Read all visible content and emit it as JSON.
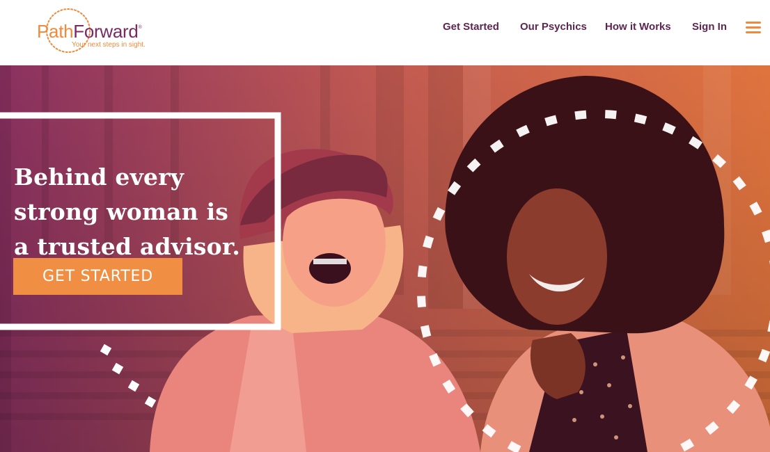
{
  "brand": {
    "name_part1": "Path",
    "name_part2": "Forward",
    "trademark": "®",
    "tagline": "Your next steps in sight.",
    "colors": {
      "orange": "#f08a3a",
      "plum": "#7a2a63"
    }
  },
  "nav": {
    "links": [
      {
        "label": "Get Started"
      },
      {
        "label": "Our Psychics"
      },
      {
        "label": "How it Works"
      },
      {
        "label": "Sign In"
      }
    ],
    "menu_icon": "hamburger-icon"
  },
  "hero": {
    "headline_lines": [
      "Behind every",
      "strong woman is",
      "a trusted advisor."
    ],
    "cta_label": "GET STARTED",
    "photo_description_icon": "two-laughing-women-photo",
    "overlay_colors": {
      "left": "#8a3160",
      "right": "#e0743e"
    }
  }
}
